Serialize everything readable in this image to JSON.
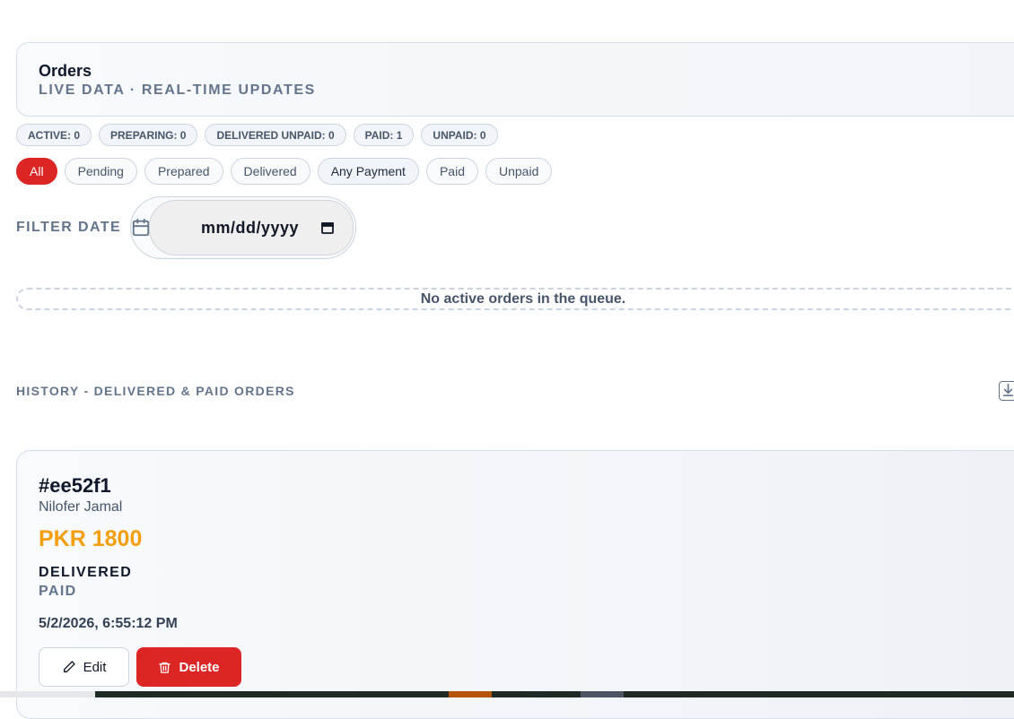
{
  "header": {
    "title": "Orders",
    "subtitle": "LIVE DATA · REAL-TIME UPDATES"
  },
  "stats": [
    {
      "label": "ACTIVE: 0"
    },
    {
      "label": "PREPARING: 0"
    },
    {
      "label": "DELIVERED UNPAID: 0"
    },
    {
      "label": "PAID: 1"
    },
    {
      "label": "UNPAID: 0"
    }
  ],
  "filters": [
    {
      "label": "All",
      "active": true
    },
    {
      "label": "Pending"
    },
    {
      "label": "Prepared"
    },
    {
      "label": "Delivered"
    },
    {
      "label": "Any Payment"
    },
    {
      "label": "Paid"
    },
    {
      "label": "Unpaid"
    }
  ],
  "date_filter": {
    "label": "FILTER DATE",
    "value": "mm/dd/yyyy"
  },
  "queue": {
    "empty_text": "No active orders in the queue."
  },
  "history": {
    "title": "HISTORY - DELIVERED & PAID ORDERS"
  },
  "order": {
    "id": "#ee52f1",
    "customer": "Nilofer Jamal",
    "amount": "PKR 1800",
    "status": "DELIVERED",
    "payment": "PAID",
    "timestamp": "5/2/2026, 6:55:12 PM",
    "edit_label": "Edit",
    "delete_label": "Delete"
  },
  "colors": {
    "accent": "#dc2626",
    "amount": "#f59e0b",
    "muted": "#64748b"
  }
}
